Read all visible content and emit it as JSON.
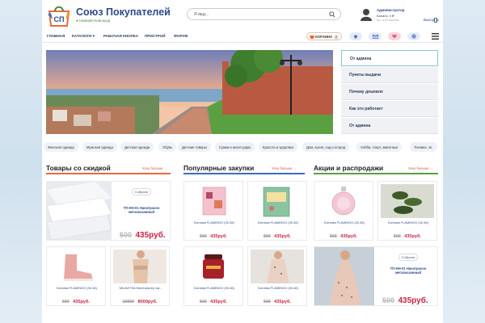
{
  "header": {
    "site_name": "Союз Покупателей",
    "logo_text": "СП",
    "city": "Нижний Новгород",
    "search_placeholder": "Я ищу...",
    "user": {
      "name": "Администратор",
      "balance": "Баланс: 0 ₽",
      "subtitle": "Вы 1150 заказов",
      "logout_label": "Выход"
    }
  },
  "nav": {
    "items": [
      "Главная",
      "Каталоги",
      "Рабочая кнопка",
      "Пристрой",
      "Форум"
    ],
    "basket_label": "КОРЗИНА",
    "basket_count": "2"
  },
  "side_menu": {
    "items": [
      "От админа",
      "Пункты выдачи",
      "Почему дешевле",
      "Как это работает",
      "От админа"
    ]
  },
  "categories": [
    "Женская одежда",
    "Мужская одежда",
    "Детская одежда",
    "Обувь",
    "Детские товары",
    "Сумки и аксессуары",
    "Красота и здоровье",
    "Дом, кухня, сад и огород",
    "Хобби, спорт, животные",
    "Техника, эл."
  ],
  "sections": [
    {
      "title": "Товары со скидкой",
      "more": "Хочу больше →"
    },
    {
      "title": "Популярные закупки",
      "more": "Хочу больше →"
    },
    {
      "title": "Акции и распродажи",
      "more": "Хочу больше →"
    }
  ],
  "promo": {
    "tag": "Собрали",
    "name": "ТП-НН-01 Нанатрасно мегаоказанный",
    "old": "500",
    "new": "435руб."
  },
  "cards": [
    {
      "name": "Ботинки FLAMINGO (30-36)",
      "old": "500",
      "new": "435руб."
    },
    {
      "name": "MILAVITSA бюстгальтер чаг...",
      "old": "10000",
      "new": "8000руб."
    },
    {
      "name": "Ботинки FLAMINGO (30-36)",
      "old": "500",
      "new": "435руб."
    },
    {
      "name": "Ботинки FLAMINGO (30-36)",
      "old": "500",
      "new": "435руб."
    },
    {
      "name": "Ботинки FLAMINGO (30-36)",
      "old": "500",
      "new": "435руб."
    },
    {
      "name": "Ботинки FLAMINGO (30-36)",
      "old": "500",
      "new": "435руб."
    },
    {
      "name": "Ботинки FLAMINGO (30-36)",
      "old": "500",
      "new": "435руб."
    },
    {
      "name": "Ботинки FLAMINGO (30-36)",
      "old": "500",
      "new": "435руб."
    }
  ],
  "colors": {
    "brand_blue": "#2c4a8a",
    "accent_red": "#c22440",
    "accent_green": "#4a8a3c"
  }
}
